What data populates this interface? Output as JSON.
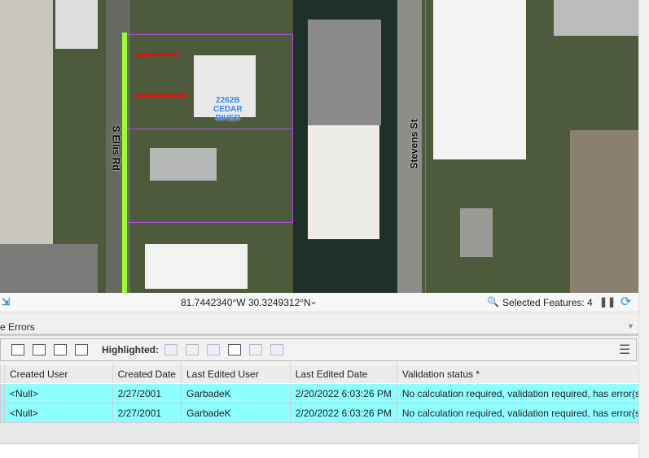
{
  "map": {
    "parcel_label": [
      "2262B",
      "CEDAR",
      "RIVER"
    ],
    "street1": "S Ellis Rd",
    "street2": "Stevens St"
  },
  "status": {
    "coords": "81.7442340°W 30.3249312°N",
    "selected": "Selected Features: 4"
  },
  "pane": {
    "title": "e Errors",
    "highlighted_label": "Highlighted:"
  },
  "table": {
    "headers": [
      "Created User",
      "Created Date",
      "Last Edited User",
      "Last Edited Date",
      "Validation status *"
    ],
    "rows": [
      [
        "<Null>",
        "2/27/2001",
        "GarbadeK",
        "2/20/2022 6:03:26 PM",
        "No calculation required, validation required, has error(s)"
      ],
      [
        "<Null>",
        "2/27/2001",
        "GarbadeK",
        "2/20/2022 6:03:26 PM",
        "No calculation required, validation required, has error(s)"
      ]
    ]
  },
  "colors": {
    "highlight": "#8effff",
    "selection": "#9cff2e",
    "parcel": "#b04fd8"
  }
}
